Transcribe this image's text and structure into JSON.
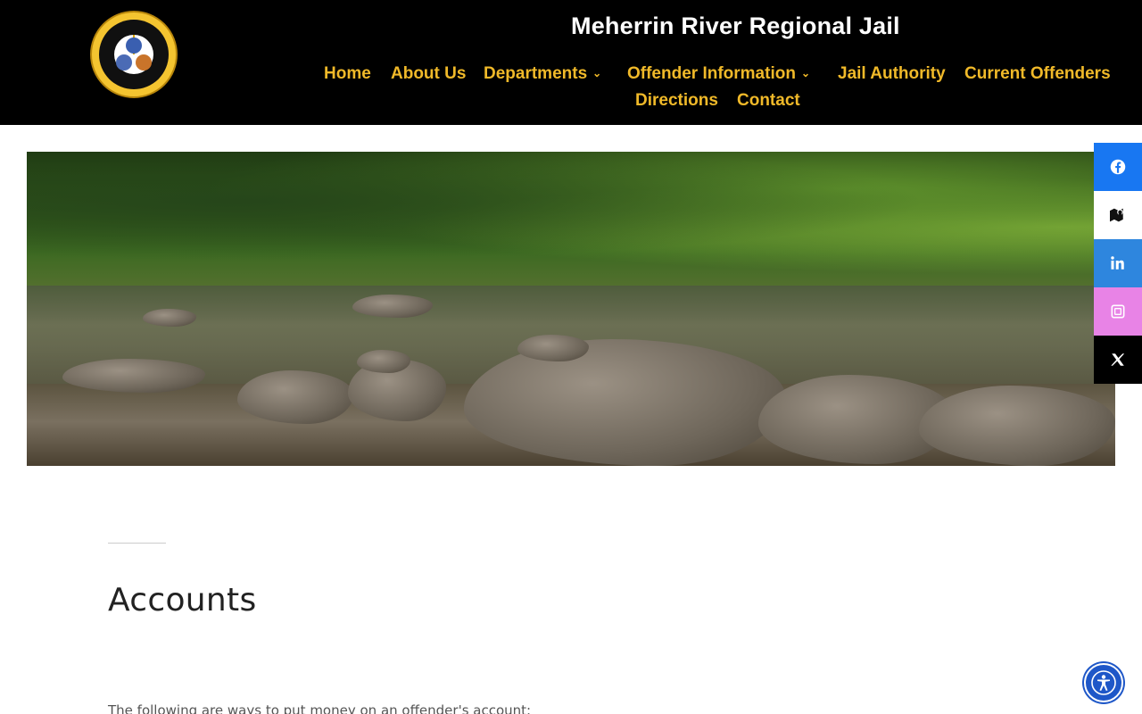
{
  "site": {
    "title": "Meherrin River Regional Jail",
    "logo": {
      "ring_text": "MEHERRIN RIVER REGIONAL JAIL",
      "state_text": "VIRGINIA",
      "colors": {
        "ring": "#f4c430",
        "inner": "#101010"
      }
    }
  },
  "nav": {
    "items": [
      {
        "label": "Home"
      },
      {
        "label": "About Us"
      },
      {
        "label": "Departments",
        "has_dropdown": true
      },
      {
        "label": "Offender Information",
        "has_dropdown": true
      },
      {
        "label": "Jail Authority"
      },
      {
        "label": "Current Offenders"
      },
      {
        "label": "Directions"
      },
      {
        "label": "Contact"
      }
    ],
    "colors": {
      "text": "#f0b929",
      "background": "#000000"
    }
  },
  "hero": {
    "image": "river-with-rocks-and-trees"
  },
  "main": {
    "heading": "Accounts",
    "intro": "The following are ways to put money on an offender's account:"
  },
  "social": {
    "buttons": [
      {
        "icon": "facebook-icon",
        "color": "#1877f2"
      },
      {
        "icon": "map-icon",
        "color": "#ffffff"
      },
      {
        "icon": "linkedin-icon",
        "color": "#2e86de"
      },
      {
        "icon": "instagram-icon",
        "color": "#e883e6"
      },
      {
        "icon": "x-twitter-icon",
        "color": "#000000"
      }
    ]
  },
  "accessibility": {
    "icon": "accessibility-icon",
    "color": "#1e57c8"
  }
}
